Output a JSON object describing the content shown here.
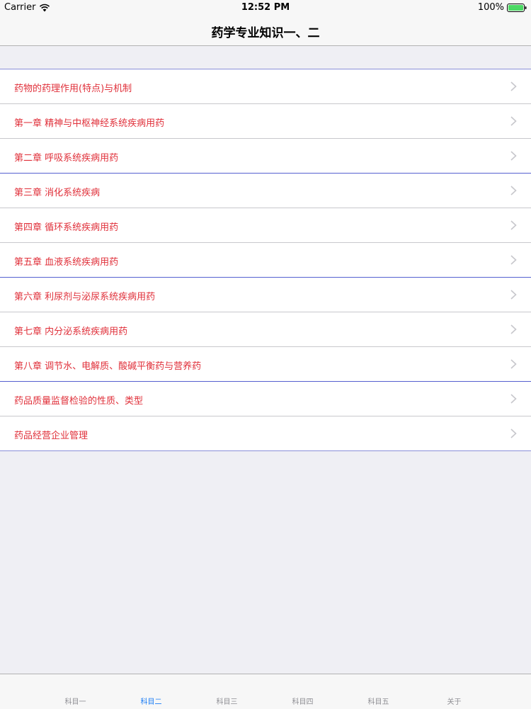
{
  "status_bar": {
    "carrier": "Carrier",
    "time": "12:52 PM",
    "battery": "100%",
    "wifi_icon": "wifi-icon",
    "battery_icon": "battery-icon",
    "battery_color": "#4cd964"
  },
  "nav": {
    "title": "药学专业知识一、二"
  },
  "list": {
    "label_color": "#e0303a",
    "items": [
      {
        "label": "药物的药理作用(特点)与机制"
      },
      {
        "label": "第一章 精神与中枢神经系统疾病用药"
      },
      {
        "label": "第二章 呼吸系统疾病用药"
      },
      {
        "label": "第三章 消化系统疾病"
      },
      {
        "label": "第四章 循环系统疾病用药"
      },
      {
        "label": "第五章 血液系统疾病用药"
      },
      {
        "label": "第六章 利尿剂与泌尿系统疾病用药"
      },
      {
        "label": "第七章 内分泌系统疾病用药"
      },
      {
        "label": "第八章 调节水、电解质、酸碱平衡药与营养药"
      },
      {
        "label": "药品质量监督检验的性质、类型"
      },
      {
        "label": "药品经营企业管理"
      }
    ]
  },
  "tab_bar": {
    "active_color": "#1a7cf5",
    "tabs": [
      {
        "label": "科目一"
      },
      {
        "label": "科目二",
        "active": true
      },
      {
        "label": "科目三"
      },
      {
        "label": "科目四"
      },
      {
        "label": "科目五"
      },
      {
        "label": "关于"
      }
    ]
  }
}
